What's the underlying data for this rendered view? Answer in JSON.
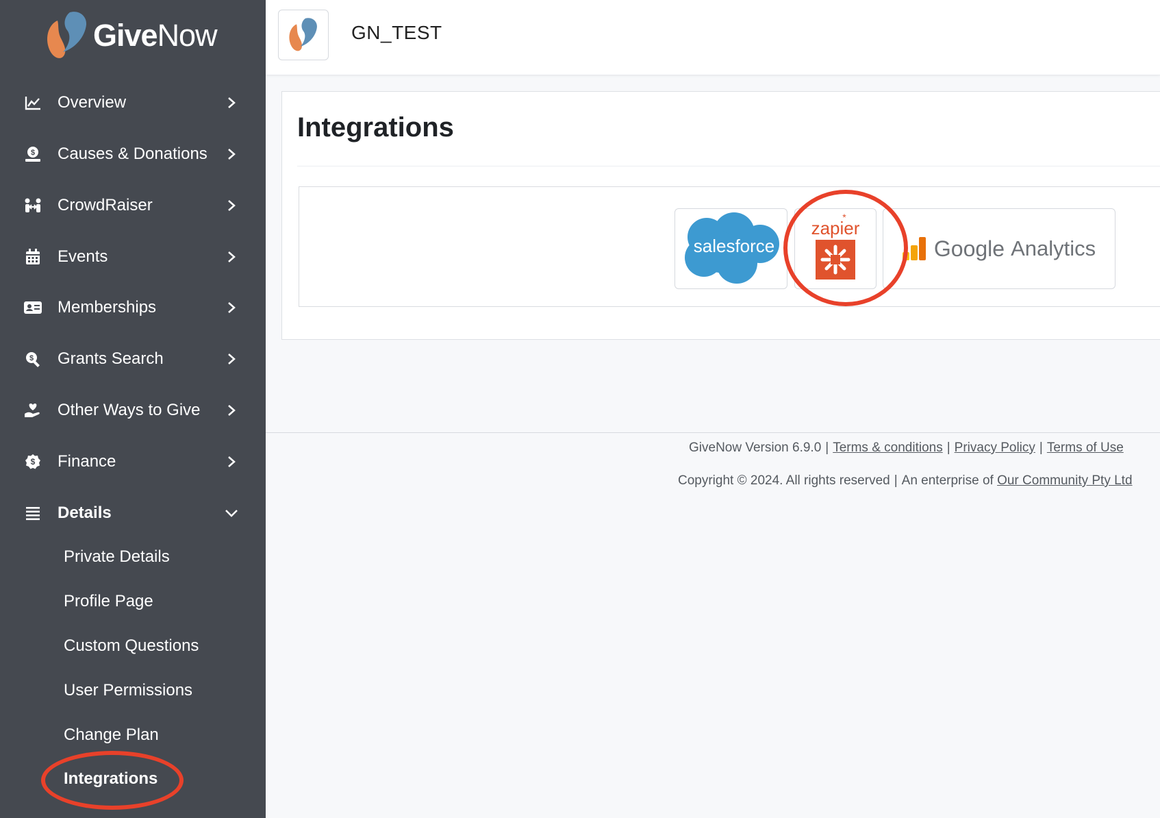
{
  "brand": {
    "name_bold": "Give",
    "name_light": "Now"
  },
  "header": {
    "org_name": "GN_TEST"
  },
  "sidebar": {
    "items": [
      {
        "label": "Overview",
        "icon": "chart-line-icon"
      },
      {
        "label": "Causes & Donations",
        "icon": "donation-icon"
      },
      {
        "label": "CrowdRaiser",
        "icon": "people-icon"
      },
      {
        "label": "Events",
        "icon": "calendar-icon"
      },
      {
        "label": "Memberships",
        "icon": "id-card-icon"
      },
      {
        "label": "Grants Search",
        "icon": "search-dollar-icon"
      },
      {
        "label": "Other Ways to Give",
        "icon": "hand-heart-icon"
      },
      {
        "label": "Finance",
        "icon": "dollar-badge-icon"
      },
      {
        "label": "Details",
        "icon": "list-icon"
      }
    ],
    "details_subitems": [
      {
        "label": "Private Details"
      },
      {
        "label": "Profile Page"
      },
      {
        "label": "Custom Questions"
      },
      {
        "label": "User Permissions"
      },
      {
        "label": "Change Plan"
      },
      {
        "label": "Integrations"
      }
    ]
  },
  "main": {
    "title": "Integrations",
    "integrations": [
      {
        "name": "salesforce",
        "logo_text": "salesforce",
        "color": "#3d9ad1"
      },
      {
        "name": "zapier",
        "logo_text": "zapier",
        "color": "#e0532d"
      },
      {
        "name": "google-analytics",
        "logo_text_1": "Google",
        "logo_text_2": "Analytics",
        "color": "#f4b400"
      }
    ]
  },
  "footer": {
    "version": "GiveNow Version 6.9.0",
    "pipe": "|",
    "terms": "Terms & conditions",
    "privacy": "Privacy Policy",
    "terms_of_use": "Terms of Use",
    "copyright": "Copyright © 2024. All rights reserved",
    "enterprise_prefix": "An enterprise of",
    "company": "Our Community Pty Ltd"
  },
  "colors": {
    "sidebar_bg": "#454950",
    "highlight_ring": "#e8412a",
    "page_bg": "#f7f8fa"
  }
}
